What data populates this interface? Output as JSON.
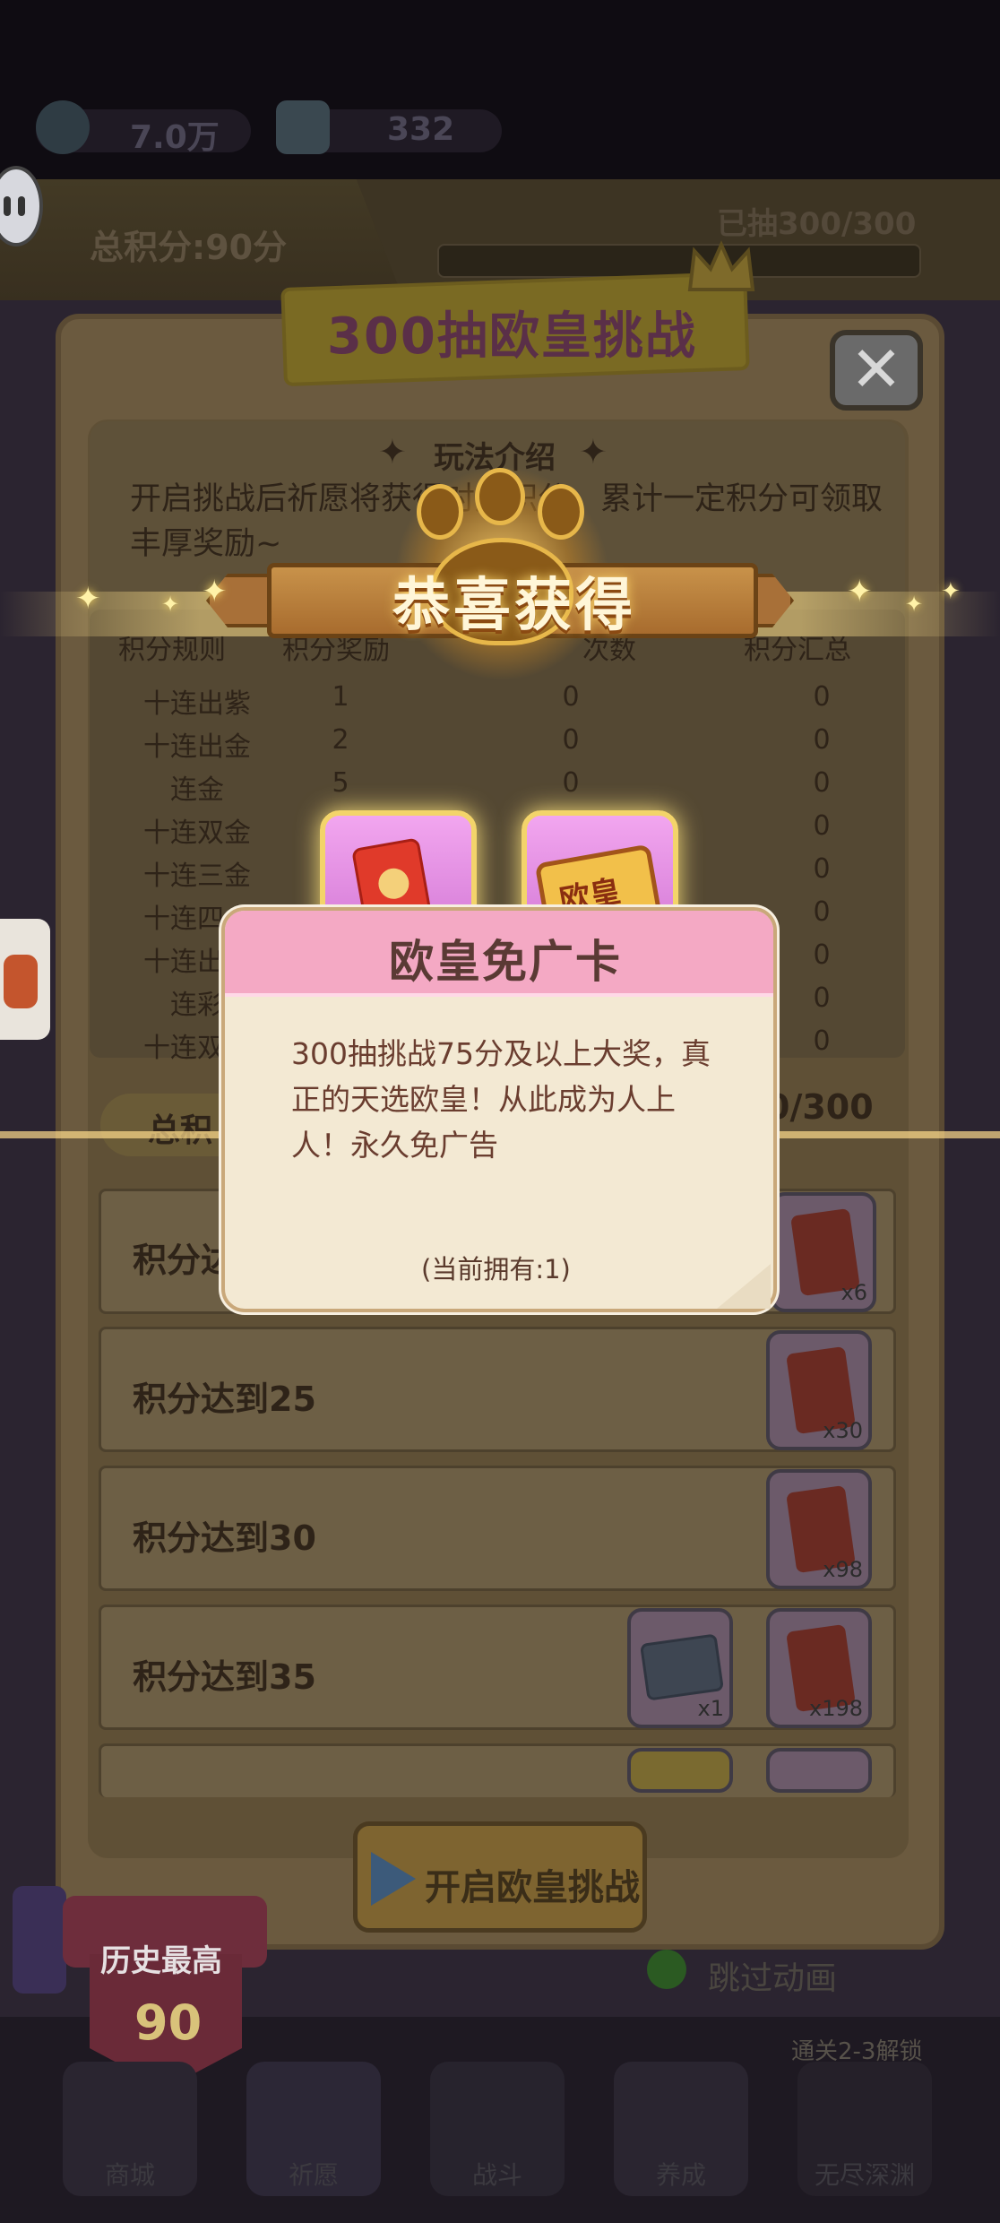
{
  "resources": {
    "coins": "7.0万",
    "gems": "332"
  },
  "score_bar": {
    "total": "总积分:90分",
    "drawn": "已抽300/300"
  },
  "dialog": {
    "title": "300抽欧皇挑战",
    "close_glyph": "✕",
    "intro_title": "玩法介绍",
    "intro_star": "✦",
    "intro_text": "开启挑战后祈愿将获得对应积分，累计一定积分可领取丰厚奖励~",
    "table_headers": [
      "积分规则",
      "积分奖励",
      "次数",
      "积分汇总"
    ],
    "rules": [
      {
        "name": "十连出紫",
        "points": "1",
        "count": "0",
        "sum": "0"
      },
      {
        "name": "十连出金",
        "points": "2",
        "count": "0",
        "sum": "0"
      },
      {
        "name": "连金",
        "points": "5",
        "count": "0",
        "sum": "0"
      },
      {
        "name": "十连双金",
        "points": "",
        "count": "",
        "sum": "0"
      },
      {
        "name": "十连三金",
        "points": "",
        "count": "",
        "sum": "0"
      },
      {
        "name": "十连四金",
        "points": "",
        "count": "",
        "sum": "0"
      },
      {
        "name": "十连出彩",
        "points": "",
        "count": "",
        "sum": "0"
      },
      {
        "name": "连彩",
        "points": "",
        "count": "",
        "sum": "0"
      },
      {
        "name": "十连双彩",
        "points": "",
        "count": "",
        "sum": "0"
      }
    ],
    "total_label": "总积",
    "total_count": "0/300",
    "reward_rows": [
      {
        "label": "积分达",
        "items": [
          {
            "type": "red-envelope",
            "count": "x6"
          }
        ]
      },
      {
        "label": "积分达到25",
        "items": [
          {
            "type": "red-envelope",
            "count": "x30"
          }
        ]
      },
      {
        "label": "积分达到30",
        "items": [
          {
            "type": "red-envelope",
            "count": "x98"
          }
        ]
      },
      {
        "label": "积分达到35",
        "items": [
          {
            "type": "ticket",
            "count": "x1"
          },
          {
            "type": "red-envelope",
            "count": "x198"
          }
        ]
      },
      {
        "label": "",
        "items": [
          {
            "type": "ticket",
            "count": ""
          },
          {
            "type": "red-envelope",
            "count": ""
          }
        ]
      }
    ],
    "start_button": "开启欧皇挑战"
  },
  "history": {
    "label": "历史最高",
    "value": "90"
  },
  "skip_animation": "跳过动画",
  "unlock_hint": "通关2-3解锁",
  "bottom_nav": [
    "商城",
    "祈愿",
    "战斗",
    "养成",
    "无尽深渊"
  ],
  "celebration": {
    "banner_text": "恭喜获得",
    "prizes": [
      {
        "type": "red-envelope",
        "label": ""
      },
      {
        "type": "ticket",
        "label": "欧皇"
      }
    ]
  },
  "card_popup": {
    "title": "欧皇免广卡",
    "description": "300抽挑战75分及以上大奖，真正的天选欧皇！从此成为人上人！永久免广告",
    "owned": "(当前拥有:1)"
  },
  "colors": {
    "popup_header": "#f4a9c4",
    "popup_body": "#f3e9d3",
    "banner_gold": "#c8924a",
    "prize_pink": "#e79ae6"
  }
}
